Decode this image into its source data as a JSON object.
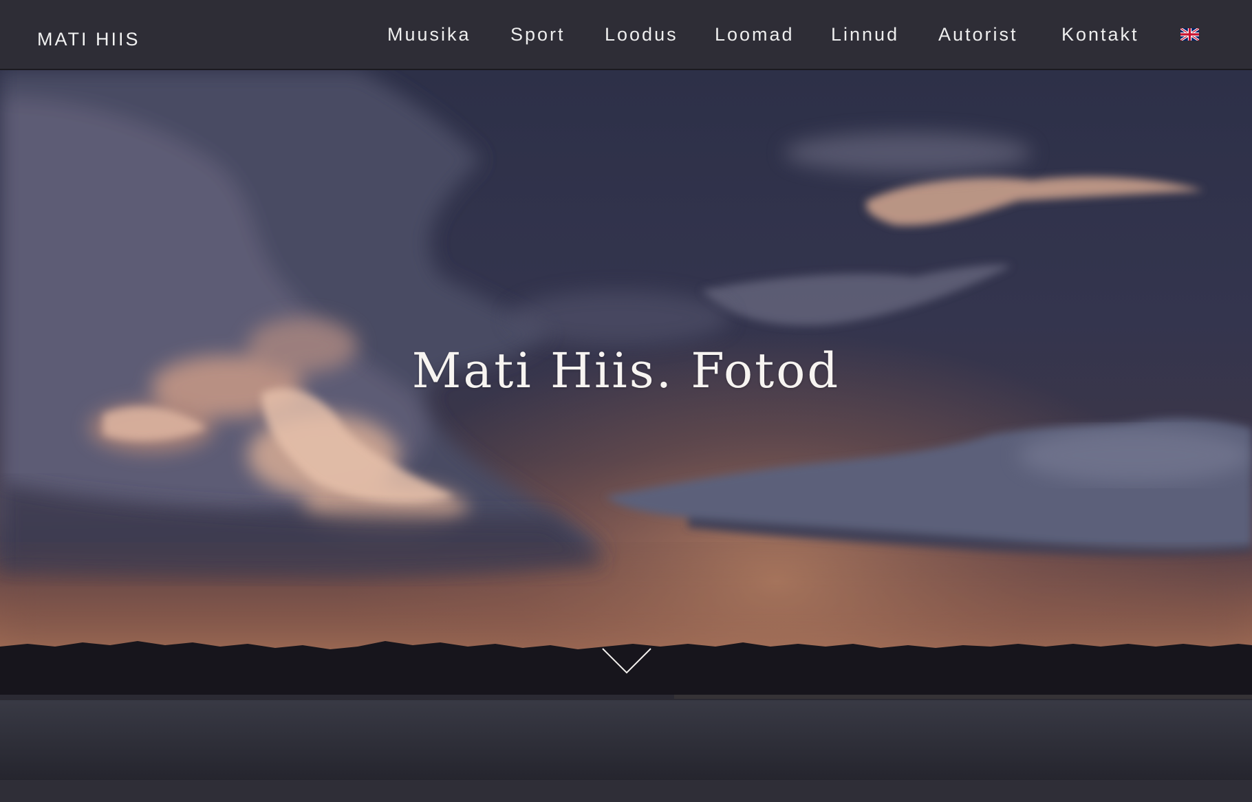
{
  "header": {
    "logo_text": "MATI HIIS",
    "nav": [
      {
        "label": "Muusika"
      },
      {
        "label": "Sport"
      },
      {
        "label": "Loodus"
      },
      {
        "label": "Loomad"
      },
      {
        "label": "Linnud"
      },
      {
        "label": "Autorist"
      },
      {
        "label": "Kontakt"
      }
    ],
    "language_switch": {
      "icon": "uk-flag-icon"
    }
  },
  "hero": {
    "title": "Mati Hiis. Fotod",
    "scroll_icon": "chevron-down-icon"
  },
  "colors": {
    "header_bg": "#2e2d36",
    "text": "#f2f2f2"
  }
}
